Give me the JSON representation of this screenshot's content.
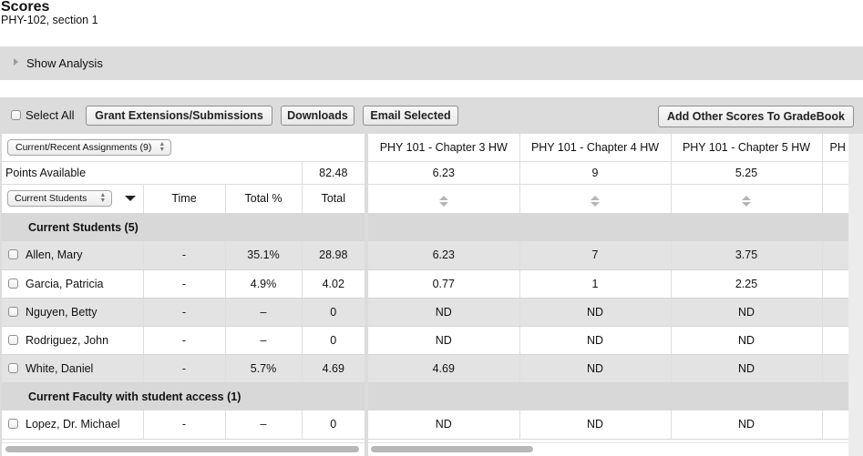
{
  "page": {
    "title": "Scores",
    "subtitle": "PHY-102, section 1"
  },
  "analysis": {
    "label": "Show Analysis",
    "icon": "triangle-right-icon"
  },
  "toolbar": {
    "select_all": "Select All",
    "grant_extensions": "Grant Extensions/Submissions",
    "downloads": "Downloads",
    "email_selected": "Email Selected",
    "add_other_scores": "Add Other Scores To GradeBook"
  },
  "filters": {
    "assignments_select": "Current/Recent Assignments (9)",
    "students_select": "Current Students"
  },
  "left_header": {
    "points_available_label": "Points Available",
    "points_available_total": "82.48",
    "columns": [
      "Time",
      "Total %",
      "Total"
    ]
  },
  "assignments": [
    {
      "name": "PHY 101 - Chapter 3 HW",
      "points": "6.23"
    },
    {
      "name": "PHY 101 - Chapter 4 HW",
      "points": "9"
    },
    {
      "name": "PHY 101 - Chapter 5 HW",
      "points": "5.25"
    },
    {
      "name": "PH",
      "points": ""
    }
  ],
  "groups": [
    {
      "label": "Current Students (5)",
      "rows": [
        {
          "name": "Allen, Mary",
          "time": "-",
          "total_pct": "35.1%",
          "total": "28.98",
          "scores": [
            "6.23",
            "7",
            "3.75"
          ]
        },
        {
          "name": "Garcia, Patricia",
          "time": "-",
          "total_pct": "4.9%",
          "total": "4.02",
          "scores": [
            "0.77",
            "1",
            "2.25"
          ]
        },
        {
          "name": "Nguyen, Betty",
          "time": "-",
          "total_pct": "–",
          "total": "0",
          "scores": [
            "ND",
            "ND",
            "ND"
          ]
        },
        {
          "name": "Rodriguez, John",
          "time": "-",
          "total_pct": "–",
          "total": "0",
          "scores": [
            "ND",
            "ND",
            "ND"
          ]
        },
        {
          "name": "White, Daniel",
          "time": "-",
          "total_pct": "5.7%",
          "total": "4.69",
          "scores": [
            "4.69",
            "ND",
            "ND"
          ]
        }
      ]
    },
    {
      "label": "Current Faculty with student access (1)",
      "rows": [
        {
          "name": "Lopez, Dr. Michael",
          "time": "-",
          "total_pct": "–",
          "total": "0",
          "scores": [
            "ND",
            "ND",
            "ND"
          ]
        }
      ]
    }
  ]
}
